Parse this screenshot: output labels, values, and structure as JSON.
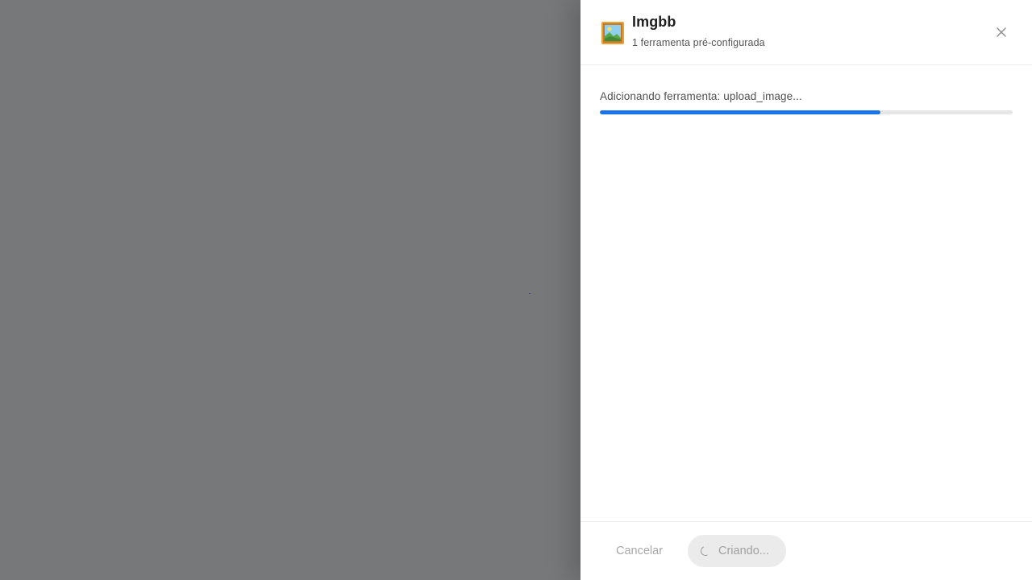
{
  "drawer": {
    "icon": "framed-picture-icon",
    "title": "Imgbb",
    "subtitle": "1 ferramenta pré-configurada"
  },
  "progress": {
    "label": "Adicionando ferramenta: upload_image...",
    "percent": 68
  },
  "footer": {
    "cancel_label": "Cancelar",
    "create_label": "Criando..."
  },
  "colors": {
    "accent": "#1a73e8",
    "backdrop": "#77787a"
  }
}
